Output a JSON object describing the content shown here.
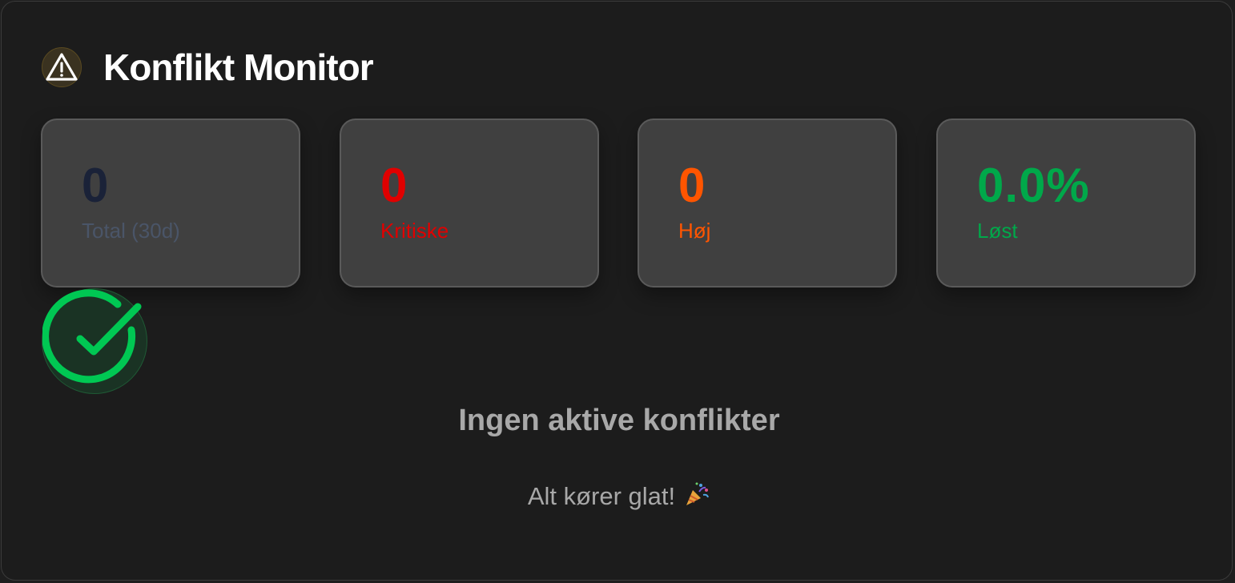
{
  "header": {
    "title": "Konflikt Monitor",
    "icon": "warning-triangle-icon"
  },
  "stats": [
    {
      "value": "0",
      "label": "Total (30d)",
      "value_color": "#1a2238",
      "label_color": "#4a5568"
    },
    {
      "value": "0",
      "label": "Kritiske",
      "value_color": "#e00000",
      "label_color": "#e00000"
    },
    {
      "value": "0",
      "label": "Høj",
      "value_color": "#ff5500",
      "label_color": "#ff5500"
    },
    {
      "value": "0.0%",
      "label": "Løst",
      "value_color": "#00a84a",
      "label_color": "#00a84a"
    }
  ],
  "empty_state": {
    "icon": "check-circle-icon",
    "title": "Ingen aktive konflikter",
    "subtitle": "Alt kører glat!",
    "emoji_icon": "party-popper-icon"
  },
  "colors": {
    "success": "#00c853",
    "warning": "#f2c94c"
  }
}
